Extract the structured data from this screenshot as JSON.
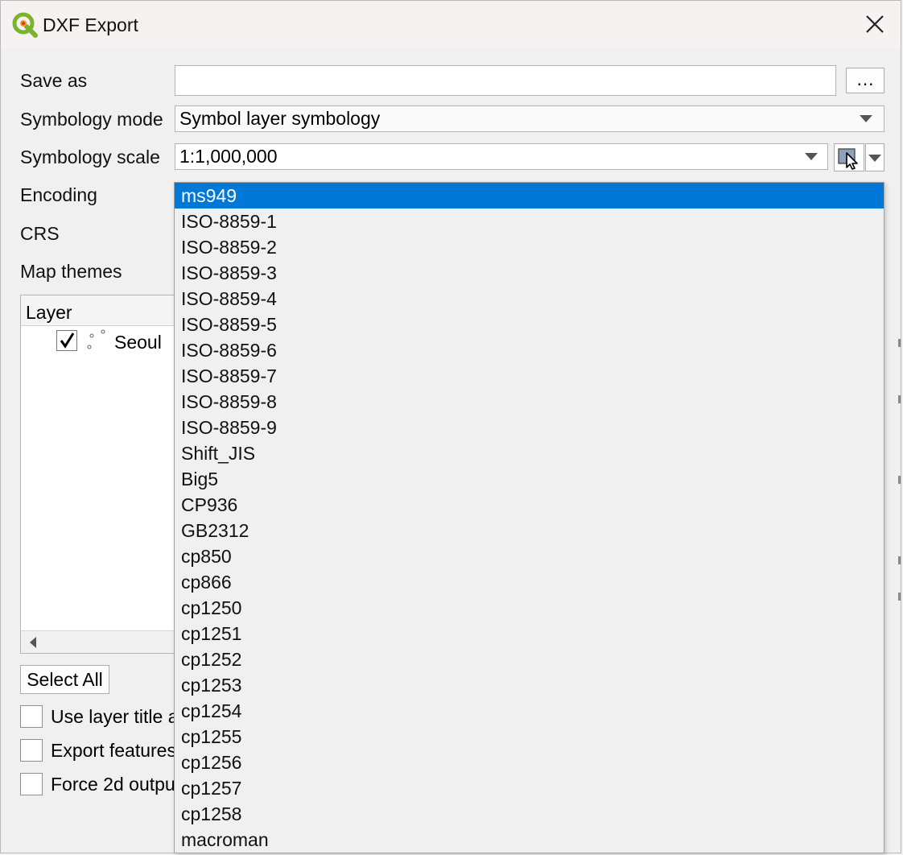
{
  "window": {
    "title": "DXF Export",
    "app_icon": "qgis-logo-icon",
    "close_icon": "close-icon"
  },
  "form": {
    "save_as": {
      "label": "Save as",
      "value": "",
      "browse_label": "…"
    },
    "symbology_mode": {
      "label": "Symbology mode",
      "value": "Symbol layer symbology"
    },
    "symbology_scale": {
      "label": "Symbology scale",
      "value": "1:1,000,000",
      "map_tool_icon": "map-canvas-scale-icon"
    },
    "encoding": {
      "label": "Encoding"
    },
    "crs": {
      "label": "CRS"
    },
    "map_themes": {
      "label": "Map themes"
    }
  },
  "layers": {
    "header": "Layer",
    "items": [
      {
        "name": "Seoul",
        "checked": true,
        "icon": "point-layer-icon"
      }
    ]
  },
  "buttons": {
    "select_all": "Select All"
  },
  "options": [
    {
      "label": "Use layer title a",
      "checked": false
    },
    {
      "label": "Export features",
      "checked": false
    },
    {
      "label": "Force 2d outpu",
      "checked": false
    }
  ],
  "encoding_dropdown": {
    "selected": "ms949",
    "items": [
      "ms949",
      "ISO-8859-1",
      "ISO-8859-2",
      "ISO-8859-3",
      "ISO-8859-4",
      "ISO-8859-5",
      "ISO-8859-6",
      "ISO-8859-7",
      "ISO-8859-8",
      "ISO-8859-9",
      "Shift_JIS",
      "Big5",
      "CP936",
      "GB2312",
      "cp850",
      "cp866",
      "cp1250",
      "cp1251",
      "cp1252",
      "cp1253",
      "cp1254",
      "cp1255",
      "cp1256",
      "cp1257",
      "cp1258",
      "macroman"
    ]
  },
  "colors": {
    "selection": "#0078d7",
    "dialog_bg": "#f0f0f0",
    "titlebar_bg": "#f7f2f2"
  }
}
